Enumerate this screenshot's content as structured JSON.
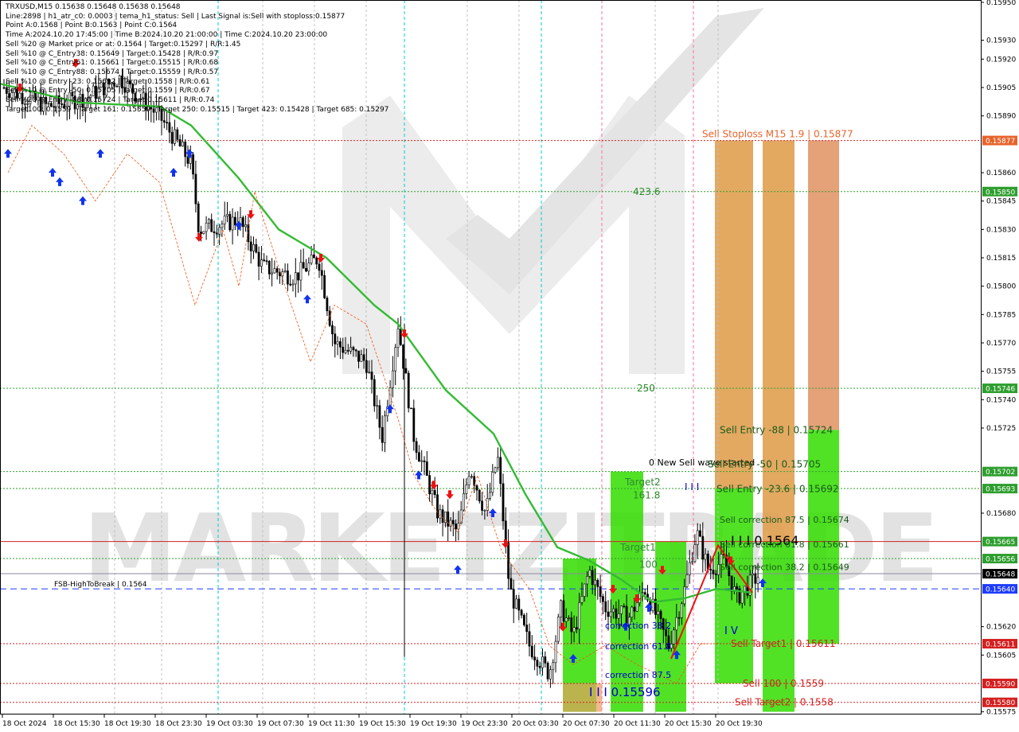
{
  "info_lines": [
    "TRXUSD,M15  0.15638 0.15648 0.15638 0.15648",
    "Line:2898  |  h1_atr_c0: 0.0003  |  tema_h1_status: Sell  |  Last Signal is:Sell with stoploss:0.15877",
    "Point A:0.1568  |  Point B:0.1563  |  Point C:0.1564",
    "Time A:2024.10.20 17:45:00  |  Time B:2024.10.20 21:00:00  |  Time C:2024.10.20 23:00:00",
    "Sell %20 @ Market price or at: 0.1564  |  Target:0.15297  |  R/R:1.45",
    "Sell %10 @ C_Entry38: 0.15649  |  Target:0.15428  |  R/R:0.97",
    "Sell %10 @ C_Entry61: 0.15661  |  Target:0.15515  |  R/R:0.68",
    "Sell %10 @ C_Entry88: 0.15674  |  Target:0.15559  |  R/R:0.57",
    "Sell %10 @ Entry -23: 0.15692  |  Target:0.1558  |  R/R:0.61",
    "Sell %10 @ Entry -50: 0.15705  |  Target:0.1559  |  R/R:0.67",
    "Sell %20 @ Entry -88: 0.15724  |  Target:0.15611  |  R/R:0.74",
    "Target100: 0.1559  |  Target 161: 0.15559  |  Target 250: 0.15515  |  Target 423: 0.15428  |  Target 685: 0.15297"
  ],
  "watermark": "MARKETZITRADE",
  "chart_data": {
    "type": "candlestick",
    "symbol": "TRXUSD",
    "timeframe": "M15",
    "ylim": [
      0.15575,
      0.1595
    ],
    "y_ticks": [
      "0.15950",
      "0.15930",
      "0.15920",
      "0.15905",
      "0.15890",
      "0.15877",
      "0.15860",
      "0.15850",
      "0.15845",
      "0.15830",
      "0.15815",
      "0.15800",
      "0.15785",
      "0.15770",
      "0.15755",
      "0.15746",
      "0.15740",
      "0.15725",
      "0.15702",
      "0.15693",
      "0.15680",
      "0.15665",
      "0.15656",
      "0.15648",
      "0.15640",
      "0.15620",
      "0.15611",
      "0.15605",
      "0.15590",
      "0.15580",
      "0.15575"
    ],
    "x_ticks": [
      "18 Oct 2024",
      "18 Oct 15:30",
      "18 Oct 19:30",
      "18 Oct 23:30",
      "19 Oct 03:30",
      "19 Oct 07:30",
      "19 Oct 11:30",
      "19 Oct 15:30",
      "19 Oct 19:30",
      "19 Oct 23:30",
      "20 Oct 03:30",
      "20 Oct 07:30",
      "20 Oct 11:30",
      "20 Oct 15:30",
      "20 Oct 19:30"
    ],
    "price_tags": [
      {
        "value": 0.15877,
        "text": "0.15877",
        "color": "#e8642c"
      },
      {
        "value": 0.1585,
        "text": "0.15850",
        "color": "#2e9e2e"
      },
      {
        "value": 0.15746,
        "text": "0.15746",
        "color": "#2e9e2e"
      },
      {
        "value": 0.15702,
        "text": "0.15702",
        "color": "#2e9e2e"
      },
      {
        "value": 0.15693,
        "text": "0.15693",
        "color": "#2e9e2e"
      },
      {
        "value": 0.15665,
        "text": "0.15665",
        "color": "#2e9e2e"
      },
      {
        "value": 0.15656,
        "text": "0.15656",
        "color": "#2e9e2e"
      },
      {
        "value": 0.15648,
        "text": "0.15648",
        "color": "#000000"
      },
      {
        "value": 0.1564,
        "text": "0.15640",
        "color": "#1e3cff"
      },
      {
        "value": 0.15611,
        "text": "0.15611",
        "color": "#d42020"
      },
      {
        "value": 0.1559,
        "text": "0.15590",
        "color": "#d42020"
      },
      {
        "value": 0.1558,
        "text": "0.15580",
        "color": "#d42020"
      }
    ],
    "hlines": [
      {
        "value": 0.15877,
        "color": "#d42020",
        "style": "dot"
      },
      {
        "value": 0.1585,
        "color": "#2e9e2e",
        "style": "dot"
      },
      {
        "value": 0.15746,
        "color": "#2e9e2e",
        "style": "dot"
      },
      {
        "value": 0.15702,
        "color": "#2e9e2e",
        "style": "dot"
      },
      {
        "value": 0.15693,
        "color": "#2e9e2e",
        "style": "dot"
      },
      {
        "value": 0.15665,
        "color": "#d42020",
        "style": "solid"
      },
      {
        "value": 0.15656,
        "color": "#2e9e2e",
        "style": "dot"
      },
      {
        "value": 0.15648,
        "color": "#8a8aa0",
        "style": "solid"
      },
      {
        "value": 0.1564,
        "color": "#1e3cff",
        "style": "dash"
      },
      {
        "value": 0.15611,
        "color": "#d42020",
        "style": "dot"
      },
      {
        "value": 0.1559,
        "color": "#d42020",
        "style": "dot"
      },
      {
        "value": 0.1558,
        "color": "#d42020",
        "style": "dot"
      }
    ],
    "labels": [
      {
        "text": "Sell Stoploss M15 1.9 | 0.15877",
        "value": 0.15877,
        "color": "#e8642c"
      },
      {
        "text": "423.6",
        "value": 0.1585,
        "color": "#2e8b2e"
      },
      {
        "text": "250",
        "value": 0.15746,
        "color": "#2e8b2e"
      },
      {
        "text": "Sell Entry -88 | 0.15724",
        "value": 0.15724,
        "color": "#1a5a1a"
      },
      {
        "text": "0 New Sell wave started",
        "value": 0.15704,
        "color": "#000000"
      },
      {
        "text": "Target2",
        "value": 0.15698,
        "color": "#2e8b2e"
      },
      {
        "text": "Sell Entry -50 | 0.15705",
        "value": 0.15705,
        "color": "#1a5a1a"
      },
      {
        "text": "161.8",
        "value": 0.15687,
        "color": "#2e8b2e"
      },
      {
        "text": "Sell Entry -23.6 | 0.15692",
        "value": 0.15692,
        "color": "#1a5a1a"
      },
      {
        "text": "Sell correction 87.5 | 0.15674",
        "value": 0.15674,
        "color": "#1a5a1a"
      },
      {
        "text": "I I I 0.1564",
        "value": 0.15664,
        "color": "#000000"
      },
      {
        "text": "Target1",
        "value": 0.15661,
        "color": "#2e8b2e"
      },
      {
        "text": "Sell correction 61.8 | 0.15661",
        "value": 0.15661,
        "color": "#1a5a1a"
      },
      {
        "text": "100",
        "value": 0.15652,
        "color": "#2e8b2e"
      },
      {
        "text": "Sell correction 38.2 | 0.15649",
        "value": 0.15649,
        "color": "#1a5a1a"
      },
      {
        "text": "FSB-HighToBreak | 0.1564",
        "value": 0.1564,
        "color": "#000000"
      },
      {
        "text": "correction 38.2",
        "value": 0.15619,
        "color": "#0000cc"
      },
      {
        "text": "correction 61.8",
        "value": 0.15608,
        "color": "#0000cc"
      },
      {
        "text": "Sell Target1 | 0.15611",
        "value": 0.15611,
        "color": "#d42020"
      },
      {
        "text": "correction 87.5",
        "value": 0.15593,
        "color": "#0000cc"
      },
      {
        "text": "Sell 100 | 0.1559",
        "value": 0.1559,
        "color": "#d42020"
      },
      {
        "text": "I I I 0.15596",
        "value": 0.15585,
        "color": "#0000cc"
      },
      {
        "text": "Sell Target2 | 0.1558",
        "value": 0.1558,
        "color": "#d42020"
      },
      {
        "text": "I V",
        "value": 0.15616,
        "color": "#0000cc"
      },
      {
        "text": "I I I",
        "value": 0.15693,
        "color": "#0000cc"
      }
    ],
    "current_price": 0.15648
  }
}
